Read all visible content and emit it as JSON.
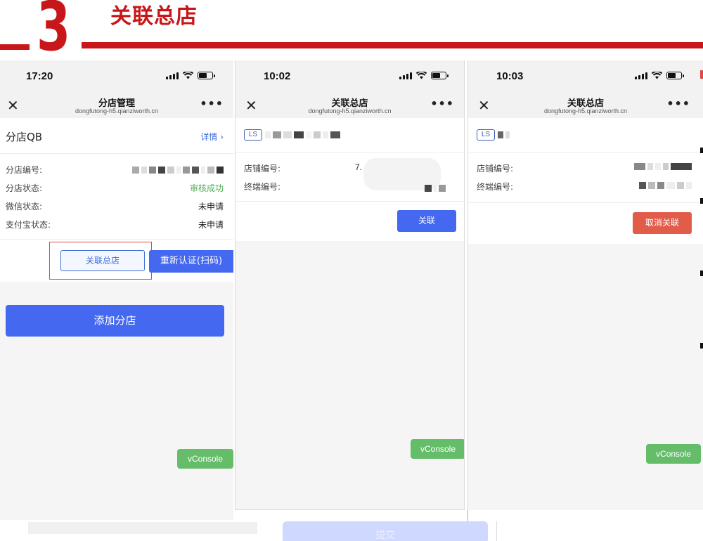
{
  "header": {
    "step_number": "3",
    "title": "关联总店"
  },
  "colors": {
    "accent_red": "#c8171a",
    "primary_blue": "#4468f0",
    "success_green": "#4cb050",
    "danger_red": "#e25c4a",
    "vconsole_green": "#65bd6a"
  },
  "phone1": {
    "time": "17:20",
    "nav_title": "分店管理",
    "nav_url": "dongfutong-h5.qianziworth.cn",
    "store_name": "分店QB",
    "detail_link": "详情 ›",
    "rows": [
      {
        "label": "分店编号:",
        "value": ""
      },
      {
        "label": "分店状态:",
        "value": "审核成功"
      },
      {
        "label": "微信状态:",
        "value": "未申请"
      },
      {
        "label": "支付宝状态:",
        "value": "未申请"
      }
    ],
    "btn_link_head": "关联总店",
    "btn_reverify": "重新认证(扫码)",
    "btn_add_branch": "添加分店",
    "vconsole": "vConsole"
  },
  "phone2": {
    "time": "10:02",
    "nav_title": "关联总店",
    "nav_url": "dongfutong-h5.qianziworth.cn",
    "badge": "LS",
    "rows": [
      {
        "label": "店铺编号:",
        "value": "7."
      },
      {
        "label": "终端编号:",
        "value": ""
      }
    ],
    "btn_link": "关联",
    "vconsole": "vConsole"
  },
  "phone3": {
    "time": "10:03",
    "nav_title": "关联总店",
    "nav_url": "dongfutong-h5.qianziworth.cn",
    "badge": "LS",
    "rows": [
      {
        "label": "店铺编号:",
        "value": ""
      },
      {
        "label": "终端编号:",
        "value": ""
      }
    ],
    "btn_unlink": "取消关联",
    "vconsole": "vConsole"
  },
  "bottom": {
    "submit": "提交"
  }
}
